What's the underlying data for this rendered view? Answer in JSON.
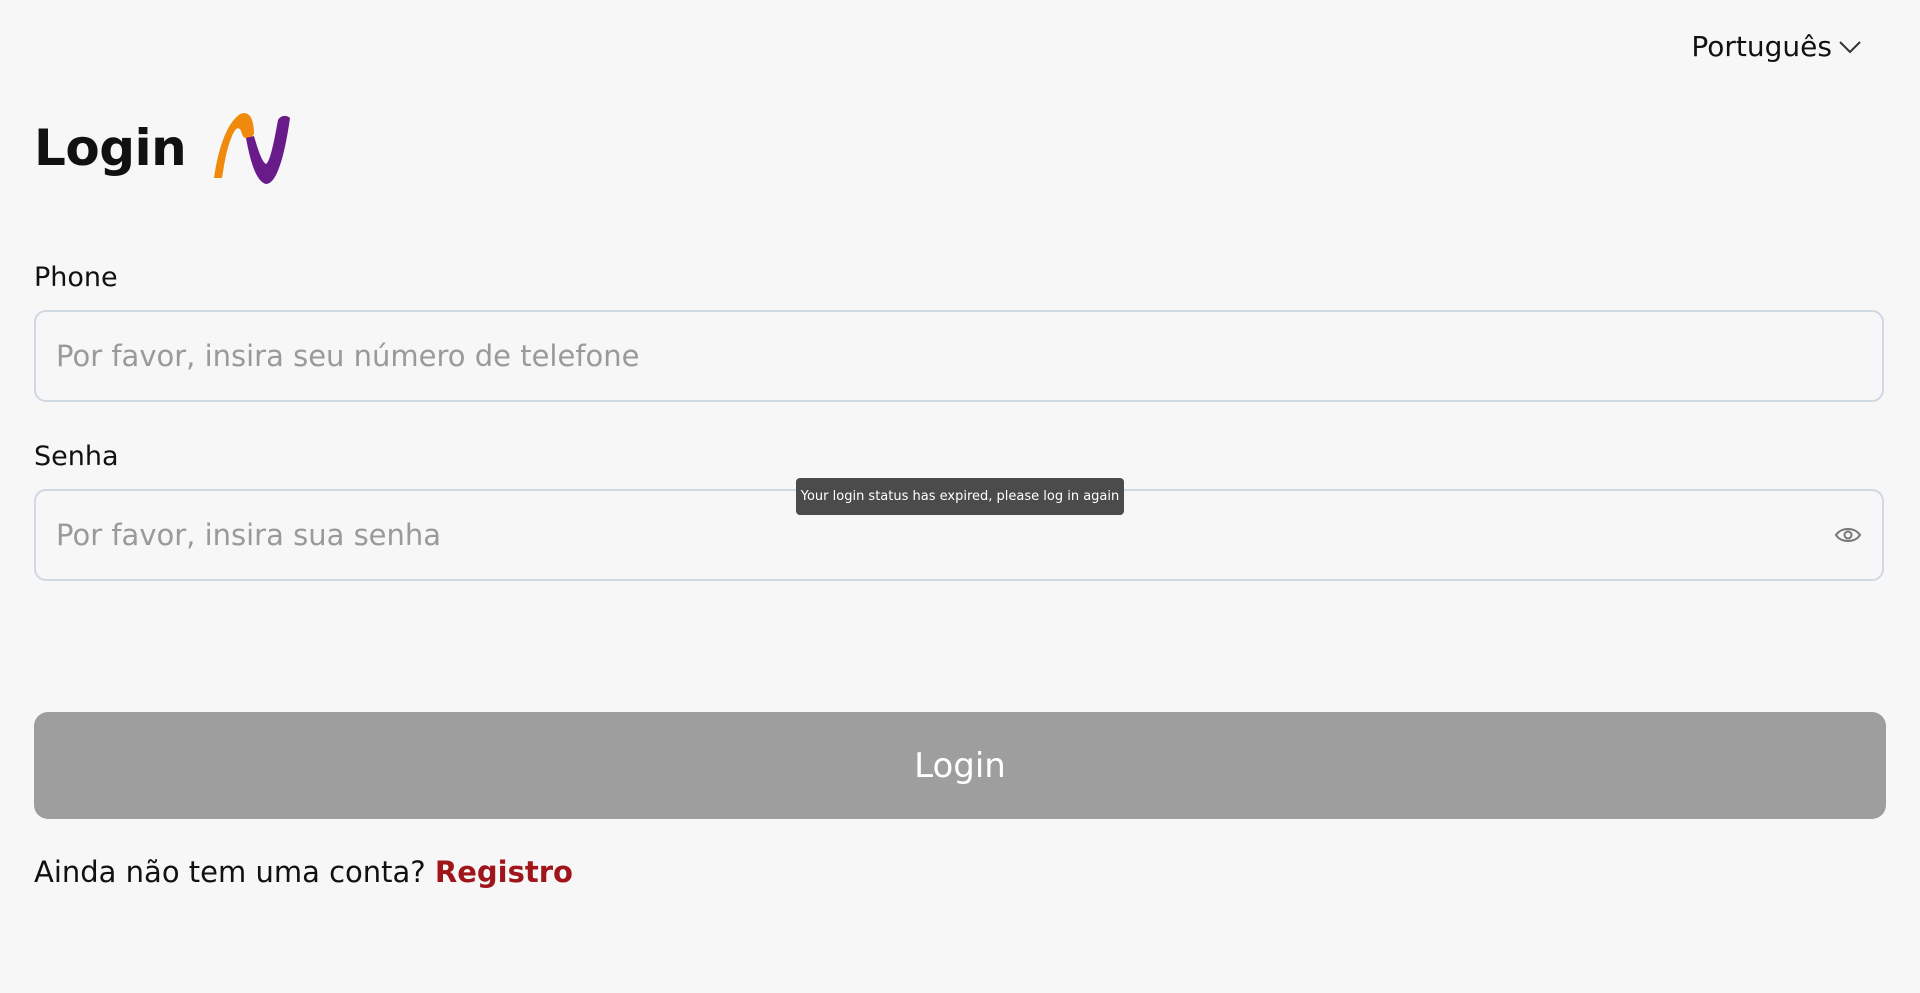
{
  "language": {
    "selected": "Português",
    "icon": "chevron-down-icon"
  },
  "header": {
    "title": "Login",
    "logo": "brand-logo"
  },
  "phone": {
    "label": "Phone",
    "placeholder": "Por favor, insira seu número de telefone",
    "value": ""
  },
  "password": {
    "label": "Senha",
    "placeholder": "Por favor, insira sua senha",
    "value": "",
    "toggle_icon": "eye-icon"
  },
  "tooltip": {
    "text": "Your login status has expired, please log in again"
  },
  "login_button": {
    "label": "Login"
  },
  "register": {
    "prompt": "Ainda não tem uma conta?",
    "link_label": "Registro"
  },
  "colors": {
    "background": "#f7f7f7",
    "button_disabled": "#9e9e9e",
    "link": "#a0151b",
    "logo_orange": "#f08a0c",
    "logo_purple": "#6a1b8a"
  }
}
